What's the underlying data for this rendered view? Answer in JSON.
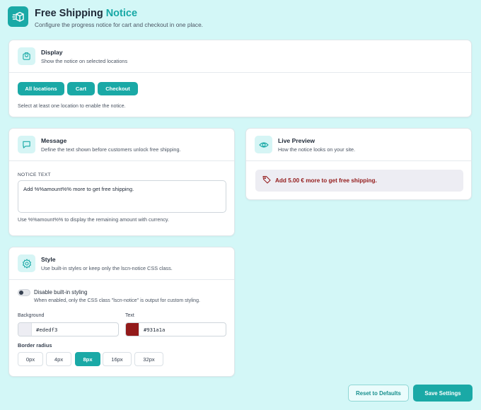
{
  "header": {
    "title_main": "Free Shipping",
    "title_accent": "Notice",
    "subtitle": "Configure the progress notice for cart and checkout in one place."
  },
  "display": {
    "title": "Display",
    "description": "Show the notice on selected locations",
    "icon": "cart-icon",
    "locations": [
      "All locations",
      "Cart",
      "Checkout"
    ],
    "hint": "Select at least one location to enable the notice."
  },
  "message": {
    "title": "Message",
    "description": "Define the text shown before customers unlock free shipping.",
    "icon": "chat-bubble-icon",
    "field_label": "NOTICE TEXT",
    "notice_text": "Add %%amount%% more to get free shipping.",
    "help": "Use %%amount%% to display the remaining amount with currency."
  },
  "preview": {
    "title": "Live Preview",
    "description": "How the notice looks on your site.",
    "icon": "eye-icon",
    "tag_icon": "tag-icon",
    "text": "Add 5.00 € more to get free shipping."
  },
  "style": {
    "title": "Style",
    "description": "Use built-in styles or keep only the lscn-notice CSS class.",
    "icon": "gear-icon",
    "toggle_label": "Disable built-in styling",
    "toggle_enabled": false,
    "toggle_help": "When enabled, only the CSS class \"lscn-notice\" is output for custom styling.",
    "background_label": "Background",
    "background_value": "#ededf3",
    "text_label": "Text",
    "text_value": "#931a1a",
    "radius_label": "Border radius",
    "radius_options": [
      "0px",
      "4px",
      "8px",
      "16px",
      "32px"
    ],
    "radius_selected": "8px"
  },
  "actions": {
    "reset": "Reset to Defaults",
    "save": "Save Settings"
  },
  "colors": {
    "accent": "#1aa9a6",
    "page_bg": "#d3f7f7",
    "preview_bg": "#ededf3",
    "preview_text": "#931a1a"
  }
}
